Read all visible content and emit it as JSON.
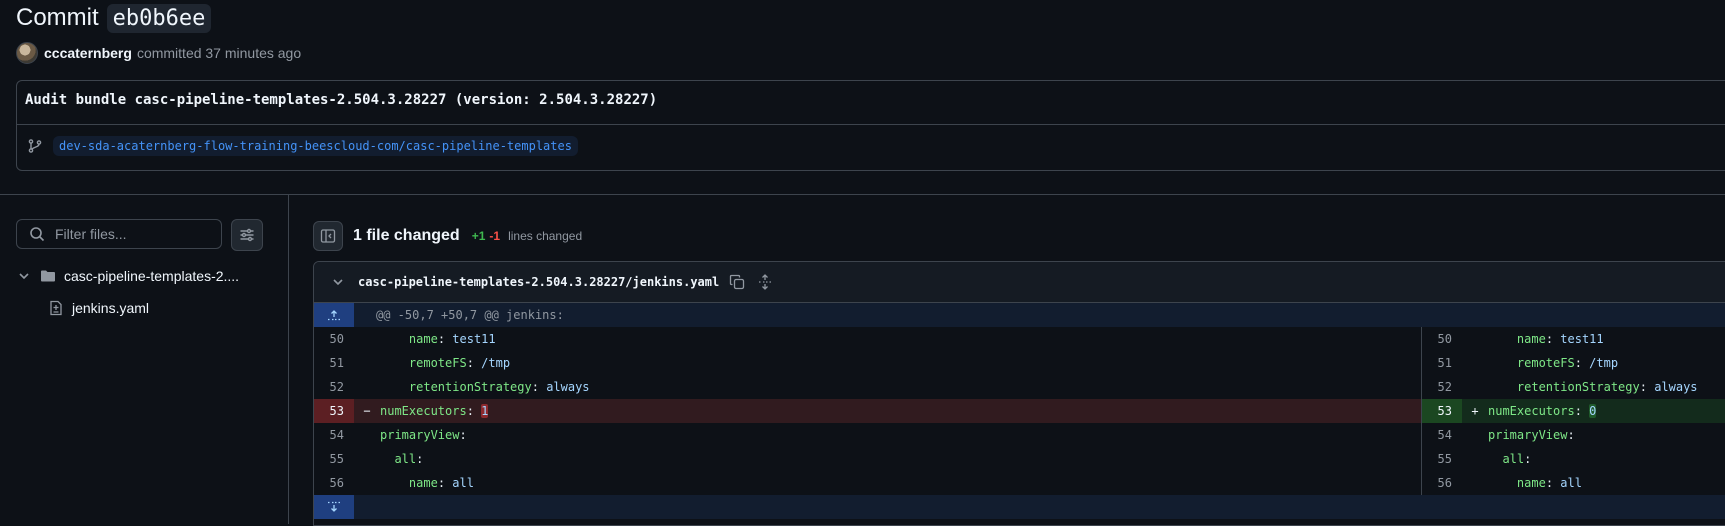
{
  "commit": {
    "title_prefix": "Commit",
    "sha": "eb0b6ee",
    "author": "cccaternberg",
    "committed_text": "committed 37 minutes ago",
    "message": "Audit bundle casc-pipeline-templates-2.504.3.28227 (version: 2.504.3.28227)",
    "branch": "dev-sda-acaternberg-flow-training-beescloud-com/casc-pipeline-templates"
  },
  "sidebar": {
    "filter_placeholder": "Filter files...",
    "folder": "casc-pipeline-templates-2....",
    "file": "jenkins.yaml"
  },
  "summary": {
    "files_changed": "1 file changed",
    "additions": "+1",
    "deletions": "-1",
    "lines_changed": "lines changed"
  },
  "diff": {
    "path": "casc-pipeline-templates-2.504.3.28227/jenkins.yaml",
    "hunk": "@@ -50,7 +50,7 @@ jenkins:",
    "rows": [
      {
        "ln": "50",
        "indent": "    ",
        "key": "name",
        "sep": ": ",
        "val": "test11"
      },
      {
        "ln": "51",
        "indent": "    ",
        "key": "remoteFS",
        "sep": ": ",
        "val": "/tmp"
      },
      {
        "ln": "52",
        "indent": "    ",
        "key": "retentionStrategy",
        "sep": ": ",
        "val": "always"
      },
      {
        "ln": "53",
        "indent": "",
        "key": "numExecutors",
        "sep": ": ",
        "old": "1",
        "new": "0"
      },
      {
        "ln": "54",
        "indent": "",
        "key": "primaryView",
        "sep": ":",
        "val": ""
      },
      {
        "ln": "55",
        "indent": "  ",
        "key": "all",
        "sep": ":",
        "val": ""
      },
      {
        "ln": "56",
        "indent": "    ",
        "key": "name",
        "sep": ": ",
        "val": "all"
      }
    ],
    "minus": "−",
    "plus": "+"
  },
  "colors": {
    "background": "#0d1117",
    "accent": "#4493f8",
    "added": "#3fb950",
    "removed": "#f85149"
  }
}
